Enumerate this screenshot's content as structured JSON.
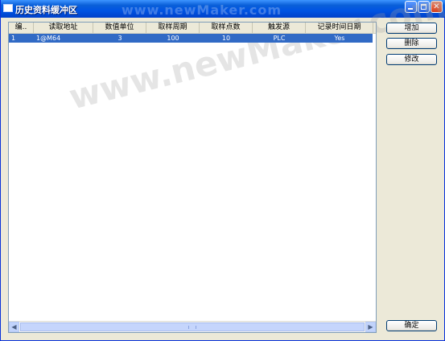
{
  "window": {
    "title": "历史资料缓冲区",
    "watermark": "www.newMaker.com"
  },
  "list": {
    "watermark": "www.newMaker.com",
    "columns": [
      "编..",
      "读取地址",
      "数值单位",
      "取样周期",
      "取样点数",
      "触发源",
      "记录时间日期"
    ],
    "rows": [
      [
        "1",
        "1@M64",
        "3",
        "100",
        "10",
        "PLC",
        "Yes"
      ]
    ]
  },
  "buttons": {
    "add": "增加",
    "delete": "删除",
    "modify": "修改",
    "ok": "确定"
  },
  "colors": {
    "titlebar": "#0054e3",
    "selection": "#316ac5",
    "dialog_bg": "#ece9d8"
  },
  "icons": {
    "minimize": "minimize-icon",
    "maximize": "maximize-icon",
    "close": "close-icon"
  }
}
